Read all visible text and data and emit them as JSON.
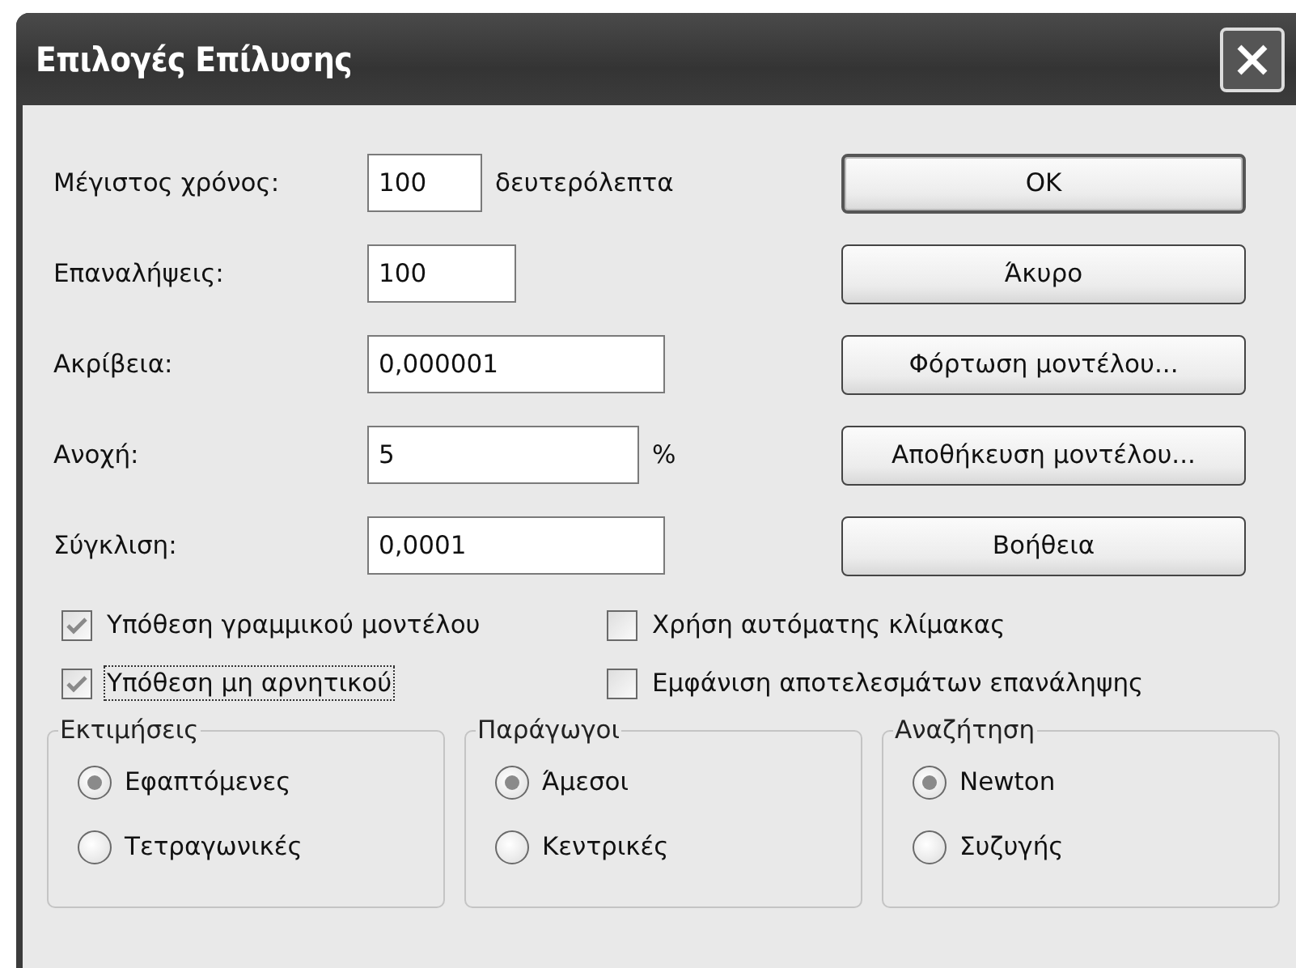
{
  "window": {
    "title": "Επιλογές Επίλυσης"
  },
  "fields": [
    {
      "label": "Μέγιστος χρόνος:",
      "value": "100",
      "unit": "δευτερόλεπτα"
    },
    {
      "label": "Επαναλήψεις:",
      "value": "100"
    },
    {
      "label": "Ακρίβεια:",
      "value": "0,000001"
    },
    {
      "label": "Ανοχή:",
      "value": "5",
      "unit": "%"
    },
    {
      "label": "Σύγκλιση:",
      "value": "0,0001"
    }
  ],
  "buttons": [
    {
      "label": "OK",
      "default": true
    },
    {
      "label": "Άκυρο",
      "default": false
    },
    {
      "label": "Φόρτωση μοντέλου...",
      "default": false
    },
    {
      "label": "Αποθήκευση μοντέλου...",
      "default": false
    },
    {
      "label": "Βοήθεια",
      "default": false
    }
  ],
  "checkboxes": [
    {
      "label": "Υπόθεση γραμμικού μοντέλου",
      "checked": true,
      "focused": false
    },
    {
      "label": "Χρήση αυτόματης κλίμακας",
      "checked": false,
      "focused": false
    },
    {
      "label": "Υπόθεση μη αρνητικού",
      "checked": true,
      "focused": true
    },
    {
      "label": "Εμφάνιση αποτελεσμάτων επανάληψης",
      "checked": false,
      "focused": false
    }
  ],
  "groups": [
    {
      "title": "Εκτιμήσεις",
      "options": [
        {
          "label": "Εφαπτόμενες",
          "selected": true
        },
        {
          "label": "Τετραγωνικές",
          "selected": false
        }
      ]
    },
    {
      "title": "Παράγωγοι",
      "options": [
        {
          "label": "Άμεσοι",
          "selected": true
        },
        {
          "label": "Κεντρικές",
          "selected": false
        }
      ]
    },
    {
      "title": "Αναζήτηση",
      "options": [
        {
          "label": "Newton",
          "selected": true
        },
        {
          "label": "Συζυγής",
          "selected": false
        }
      ]
    }
  ]
}
